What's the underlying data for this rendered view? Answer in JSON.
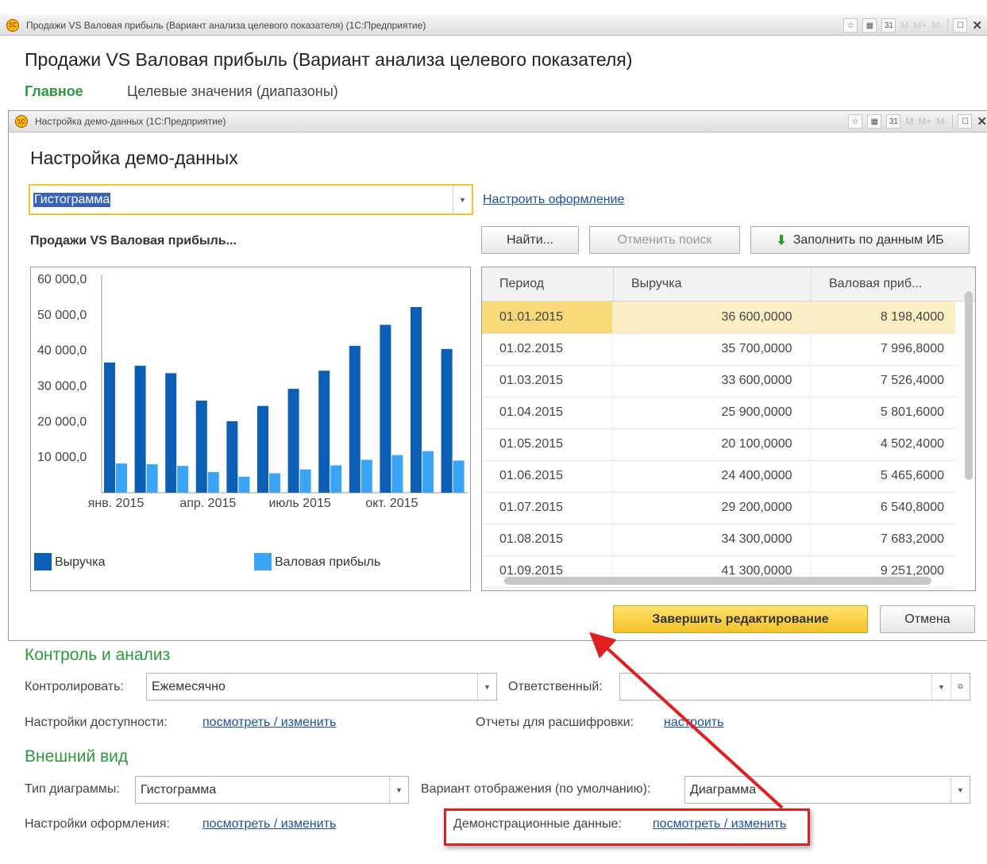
{
  "outer_window": {
    "title": "Продажи VS Валовая прибыль (Вариант анализа целевого показателя)  (1С:Предприятие)",
    "heading": "Продажи VS Валовая прибыль (Вариант анализа целевого показателя)",
    "tabs": [
      "Главное",
      "Целевые значения (диапазоны)"
    ]
  },
  "titlebar_buttons": {
    "m": "M",
    "mplus": "M+",
    "mminus": "M-"
  },
  "dialog": {
    "title": "Настройка демо-данных  (1С:Предприятие)",
    "heading": "Настройка демо-данных",
    "chart_type_value": "Гистограмма",
    "configure_link": "Настроить оформление",
    "chart_title": "Продажи VS Валовая прибыль...",
    "find_button": "Найти...",
    "cancel_search_button": "Отменить поиск",
    "fill_button": "Заполнить по данным ИБ",
    "finish_button": "Завершить редактирование",
    "cancel_button": "Отмена",
    "table": {
      "headers": [
        "Период",
        "Выручка",
        "Валовая приб..."
      ],
      "rows": [
        [
          "01.01.2015",
          "36 600,0000",
          "8 198,4000"
        ],
        [
          "01.02.2015",
          "35 700,0000",
          "7 996,8000"
        ],
        [
          "01.03.2015",
          "33 600,0000",
          "7 526,4000"
        ],
        [
          "01.04.2015",
          "25 900,0000",
          "5 801,6000"
        ],
        [
          "01.05.2015",
          "20 100,0000",
          "4 502,4000"
        ],
        [
          "01.06.2015",
          "24 400,0000",
          "5 465,6000"
        ],
        [
          "01.07.2015",
          "29 200,0000",
          "6 540,8000"
        ],
        [
          "01.08.2015",
          "34 300,0000",
          "7 683,2000"
        ],
        [
          "01.09.2015",
          "41 300,0000",
          "9 251,2000"
        ]
      ]
    }
  },
  "chart_data": {
    "type": "bar",
    "categories": [
      "01.2015",
      "02.2015",
      "03.2015",
      "04.2015",
      "05.2015",
      "06.2015",
      "07.2015",
      "08.2015",
      "09.2015",
      "10.2015",
      "11.2015",
      "12.2015"
    ],
    "tick_labels": [
      "янв. 2015",
      "апр. 2015",
      "июль 2015",
      "окт. 2015"
    ],
    "y_ticks": [
      "60 000,0",
      "50 000,0",
      "40 000,0",
      "30 000,0",
      "20 000,0",
      "10 000,0"
    ],
    "ylim": [
      0,
      60000
    ],
    "legend_position": "bottom",
    "series": [
      {
        "name": "Выручка",
        "color": "#0c5fb4",
        "values": [
          36600,
          35700,
          33600,
          25900,
          20100,
          24400,
          29200,
          34300,
          41300,
          47200,
          52200,
          40400
        ]
      },
      {
        "name": "Валовая прибыль",
        "color": "#3aa4f7",
        "values": [
          8198.4,
          7996.8,
          7526.4,
          5801.6,
          4502.4,
          5465.6,
          6540.8,
          7683.2,
          9251.2,
          10572.8,
          11692.8,
          9049.6
        ]
      }
    ]
  },
  "control": {
    "heading": "Контроль и анализ",
    "control_label": "Контролировать:",
    "control_value": "Ежемесячно",
    "responsible_label": "Ответственный:",
    "responsible_value": "",
    "access_label": "Настройки доступности:",
    "access_link": "посмотреть / изменить",
    "reports_label": "Отчеты для расшифровки:",
    "reports_link": "настроить"
  },
  "appearance": {
    "heading": "Внешний вид",
    "chart_type_label": "Тип диаграммы:",
    "chart_type_value": "Гистограмма",
    "display_label": "Вариант отображения (по умолчанию):",
    "display_value": "Диаграмма",
    "style_label": "Настройки оформления:",
    "style_link": "посмотреть / изменить",
    "demo_label": "Демонстрационные данные:",
    "demo_link": "посмотреть / изменить"
  },
  "colors": {
    "green_heading": "#2b9a3a",
    "link": "#1b4fa8",
    "highlight": "#e02020",
    "yellow_button": "#f6cc30"
  }
}
